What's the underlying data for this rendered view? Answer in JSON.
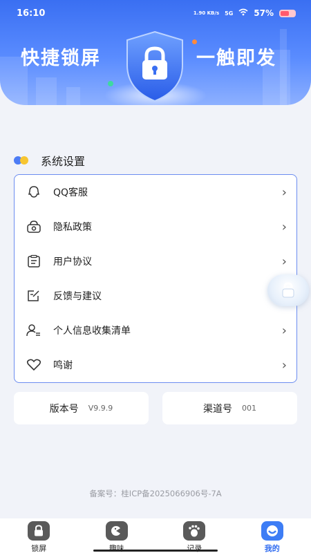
{
  "status_bar": {
    "time": "16:10",
    "net_speed": "1.90 KB/s",
    "signal": "5G",
    "battery": "57%"
  },
  "hero": {
    "left_text": "快捷锁屏",
    "right_text": "一触即发"
  },
  "section": {
    "title": "系统设置"
  },
  "settings": {
    "items": [
      {
        "label": "QQ客服",
        "icon": "qq-icon"
      },
      {
        "label": "隐私政策",
        "icon": "privacy-icon"
      },
      {
        "label": "用户协议",
        "icon": "clipboard-icon"
      },
      {
        "label": "反馈与建议",
        "icon": "feedback-icon"
      },
      {
        "label": "个人信息收集清单",
        "icon": "user-list-icon"
      },
      {
        "label": "鸣谢",
        "icon": "heart-icon"
      }
    ]
  },
  "info": {
    "version_label": "版本号",
    "version_value": "V9.9.9",
    "channel_label": "渠道号",
    "channel_value": "001"
  },
  "icp": "备案号：桂ICP备2025066906号-7A",
  "nav": {
    "items": [
      {
        "label": "锁屏",
        "icon": "lock-icon"
      },
      {
        "label": "趣味",
        "icon": "game-icon"
      },
      {
        "label": "记录",
        "icon": "footprint-icon"
      },
      {
        "label": "我的",
        "icon": "profile-icon"
      }
    ],
    "active_index": 3
  },
  "colors": {
    "banner": "#3a6ff2",
    "accent": "#2f6bf0",
    "card_border": "#6b8cf0",
    "background": "#f1f3f9"
  }
}
